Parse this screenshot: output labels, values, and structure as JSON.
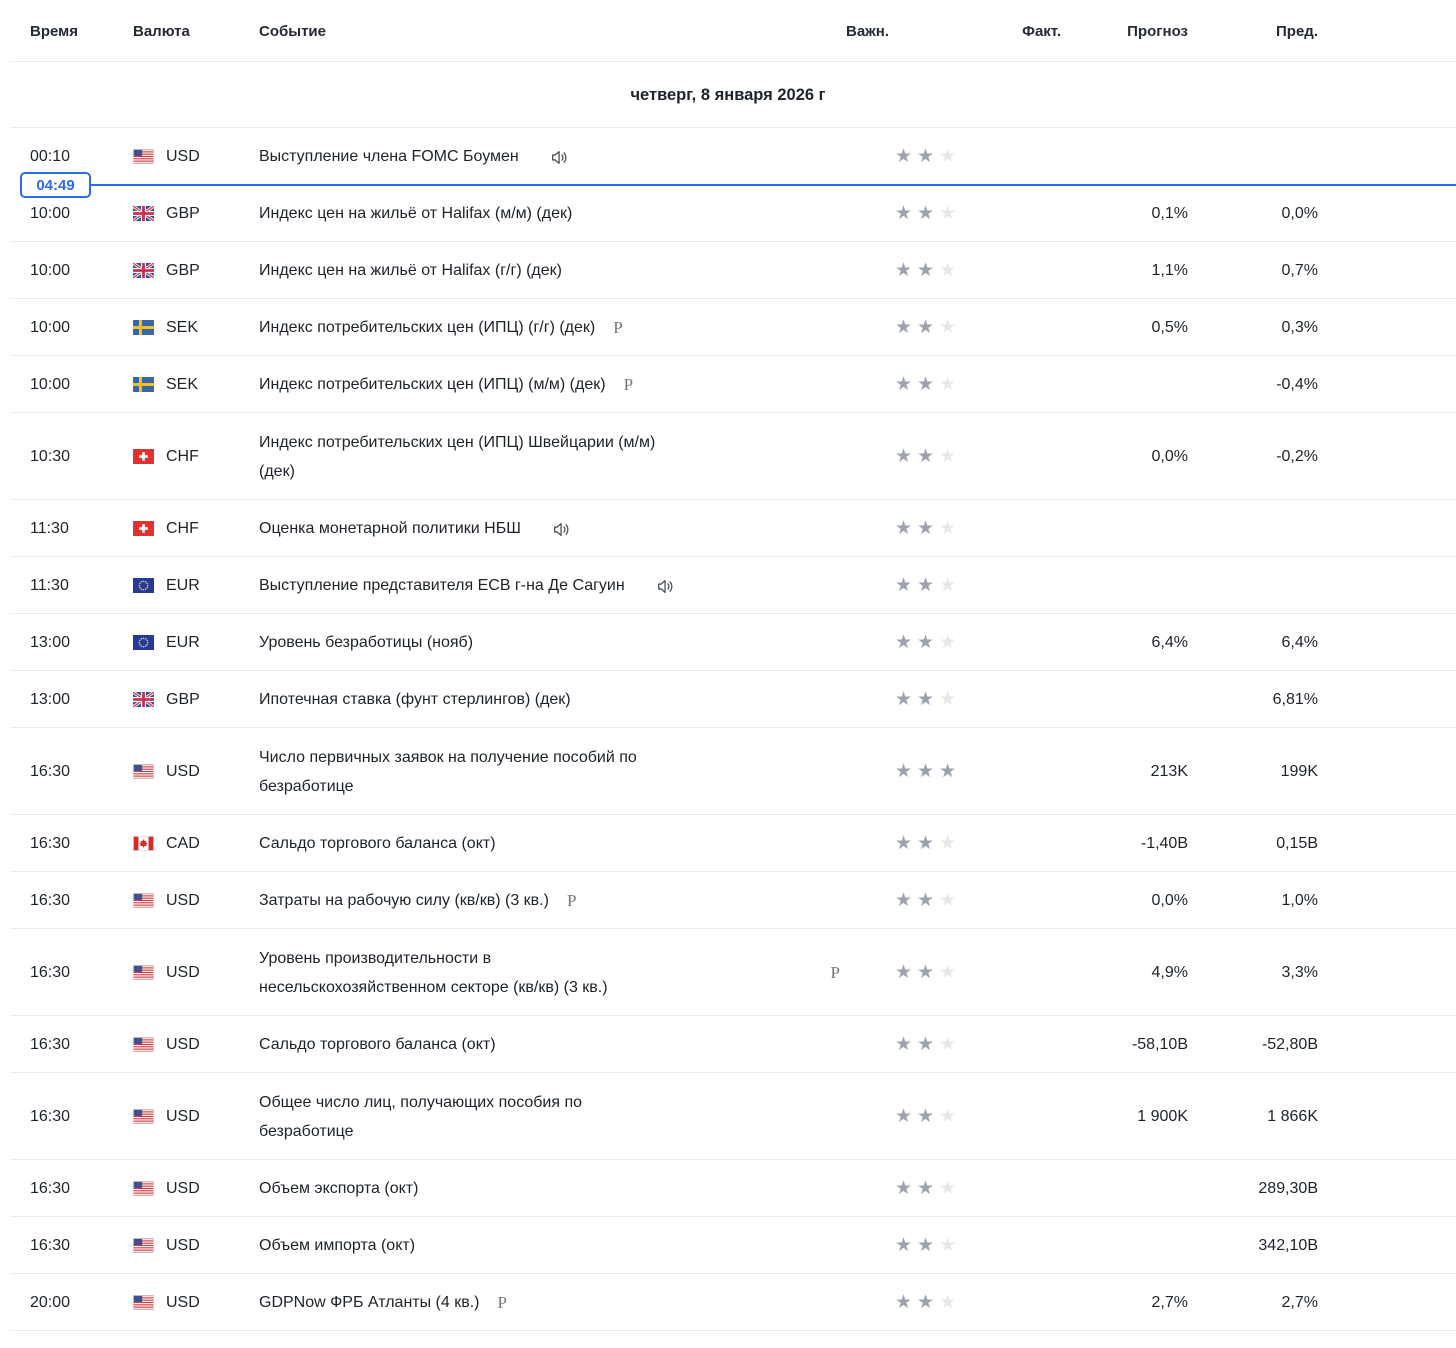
{
  "header": {
    "columns": {
      "time": "Время",
      "currency": "Валюта",
      "event": "Событие",
      "importance": "Важн.",
      "actual": "Факт.",
      "forecast": "Прогноз",
      "previous": "Пред."
    }
  },
  "date_row": {
    "label": "четверг, 8 января 2026 г"
  },
  "time_indicator": {
    "time": "04:49",
    "after_row_index": 0,
    "color": "#2b6be8"
  },
  "icons": {
    "star_glyph": "★",
    "speaker_name": "speaker-icon",
    "preliminary_glyph": "P"
  },
  "colors": {
    "accent_blue": "#2b6be8",
    "star_filled": "#9ca3af",
    "star_empty": "#e5e7eb",
    "separator": "#e8ecf1",
    "text": "#1d232b"
  },
  "rows": [
    {
      "time": "00:10",
      "flag": "us",
      "currency": "USD",
      "event": "Выступление члена FOMC Боумен",
      "voice": true,
      "marker": "",
      "marker_position": "",
      "importance": 2,
      "actual": "",
      "forecast": "",
      "previous": "",
      "tall": false
    },
    {
      "time": "10:00",
      "flag": "gb",
      "currency": "GBP",
      "event": "Индекс цен на жильё от Halifax (м/м) (дек)",
      "voice": false,
      "marker": "",
      "marker_position": "",
      "importance": 2,
      "actual": "",
      "forecast": "0,1%",
      "previous": "0,0%",
      "tall": false
    },
    {
      "time": "10:00",
      "flag": "gb",
      "currency": "GBP",
      "event": "Индекс цен на жильё от Halifax (г/г) (дек)",
      "voice": false,
      "marker": "",
      "marker_position": "",
      "importance": 2,
      "actual": "",
      "forecast": "1,1%",
      "previous": "0,7%",
      "tall": false
    },
    {
      "time": "10:00",
      "flag": "se",
      "currency": "SEK",
      "event": "Индекс потребительских цен (ИПЦ) (г/г) (дек)",
      "voice": false,
      "marker": "P",
      "marker_position": "inline",
      "importance": 2,
      "actual": "",
      "forecast": "0,5%",
      "previous": "0,3%",
      "tall": false
    },
    {
      "time": "10:00",
      "flag": "se",
      "currency": "SEK",
      "event": "Индекс потребительских цен (ИПЦ) (м/м) (дек)",
      "voice": false,
      "marker": "P",
      "marker_position": "inline",
      "importance": 2,
      "actual": "",
      "forecast": "",
      "previous": "-0,4%",
      "tall": false
    },
    {
      "time": "10:30",
      "flag": "ch",
      "currency": "CHF",
      "event": "Индекс потребительских цен (ИПЦ) Швейцарии (м/м)\n(дек)",
      "voice": false,
      "marker": "",
      "marker_position": "",
      "importance": 2,
      "actual": "",
      "forecast": "0,0%",
      "previous": "-0,2%",
      "tall": true
    },
    {
      "time": "11:30",
      "flag": "ch",
      "currency": "CHF",
      "event": "Оценка монетарной политики НБШ",
      "voice": true,
      "marker": "",
      "marker_position": "",
      "importance": 2,
      "actual": "",
      "forecast": "",
      "previous": "",
      "tall": false
    },
    {
      "time": "11:30",
      "flag": "eu",
      "currency": "EUR",
      "event": "Выступление представителя ECB г-на Де Сагуин",
      "voice": true,
      "marker": "",
      "marker_position": "",
      "importance": 2,
      "actual": "",
      "forecast": "",
      "previous": "",
      "tall": false
    },
    {
      "time": "13:00",
      "flag": "eu",
      "currency": "EUR",
      "event": "Уровень безработицы  (нояб)",
      "voice": false,
      "marker": "",
      "marker_position": "",
      "importance": 2,
      "actual": "",
      "forecast": "6,4%",
      "previous": "6,4%",
      "tall": false
    },
    {
      "time": "13:00",
      "flag": "gb",
      "currency": "GBP",
      "event": "Ипотечная ставка (фунт стерлингов)  (дек)",
      "voice": false,
      "marker": "",
      "marker_position": "",
      "importance": 2,
      "actual": "",
      "forecast": "",
      "previous": "6,81%",
      "tall": false
    },
    {
      "time": "16:30",
      "flag": "us",
      "currency": "USD",
      "event": "Число первичных заявок на получение пособий по\nбезработице",
      "voice": false,
      "marker": "",
      "marker_position": "",
      "importance": 3,
      "actual": "",
      "forecast": "213K",
      "previous": "199K",
      "tall": true
    },
    {
      "time": "16:30",
      "flag": "ca",
      "currency": "CAD",
      "event": "Сальдо торгового баланса  (окт)",
      "voice": false,
      "marker": "",
      "marker_position": "",
      "importance": 2,
      "actual": "",
      "forecast": "-1,40B",
      "previous": "0,15B",
      "tall": false
    },
    {
      "time": "16:30",
      "flag": "us",
      "currency": "USD",
      "event": "Затраты на рабочую силу (кв/кв) (3 кв.)",
      "voice": false,
      "marker": "P",
      "marker_position": "inline",
      "importance": 2,
      "actual": "",
      "forecast": "0,0%",
      "previous": "1,0%",
      "tall": false
    },
    {
      "time": "16:30",
      "flag": "us",
      "currency": "USD",
      "event": "Уровень производительности в\nнесельскохозяйственном секторе (кв/кв) (3 кв.)",
      "voice": false,
      "marker": "P",
      "marker_position": "right",
      "importance": 2,
      "actual": "",
      "forecast": "4,9%",
      "previous": "3,3%",
      "tall": true
    },
    {
      "time": "16:30",
      "flag": "us",
      "currency": "USD",
      "event": "Сальдо торгового баланса  (окт)",
      "voice": false,
      "marker": "",
      "marker_position": "",
      "importance": 2,
      "actual": "",
      "forecast": "-58,10B",
      "previous": "-52,80B",
      "tall": false
    },
    {
      "time": "16:30",
      "flag": "us",
      "currency": "USD",
      "event": "Общее число лиц, получающих пособия по\nбезработице",
      "voice": false,
      "marker": "",
      "marker_position": "",
      "importance": 2,
      "actual": "",
      "forecast": "1 900K",
      "previous": "1 866K",
      "tall": true
    },
    {
      "time": "16:30",
      "flag": "us",
      "currency": "USD",
      "event": "Объем экспорта  (окт)",
      "voice": false,
      "marker": "",
      "marker_position": "",
      "importance": 2,
      "actual": "",
      "forecast": "",
      "previous": "289,30B",
      "tall": false
    },
    {
      "time": "16:30",
      "flag": "us",
      "currency": "USD",
      "event": "Объем импорта  (окт)",
      "voice": false,
      "marker": "",
      "marker_position": "",
      "importance": 2,
      "actual": "",
      "forecast": "",
      "previous": "342,10B",
      "tall": false
    },
    {
      "time": "20:00",
      "flag": "us",
      "currency": "USD",
      "event": "GDPNow ФРБ Атланты  (4 кв.)",
      "voice": false,
      "marker": "P",
      "marker_position": "inline",
      "importance": 2,
      "actual": "",
      "forecast": "2,7%",
      "previous": "2,7%",
      "tall": false
    }
  ]
}
